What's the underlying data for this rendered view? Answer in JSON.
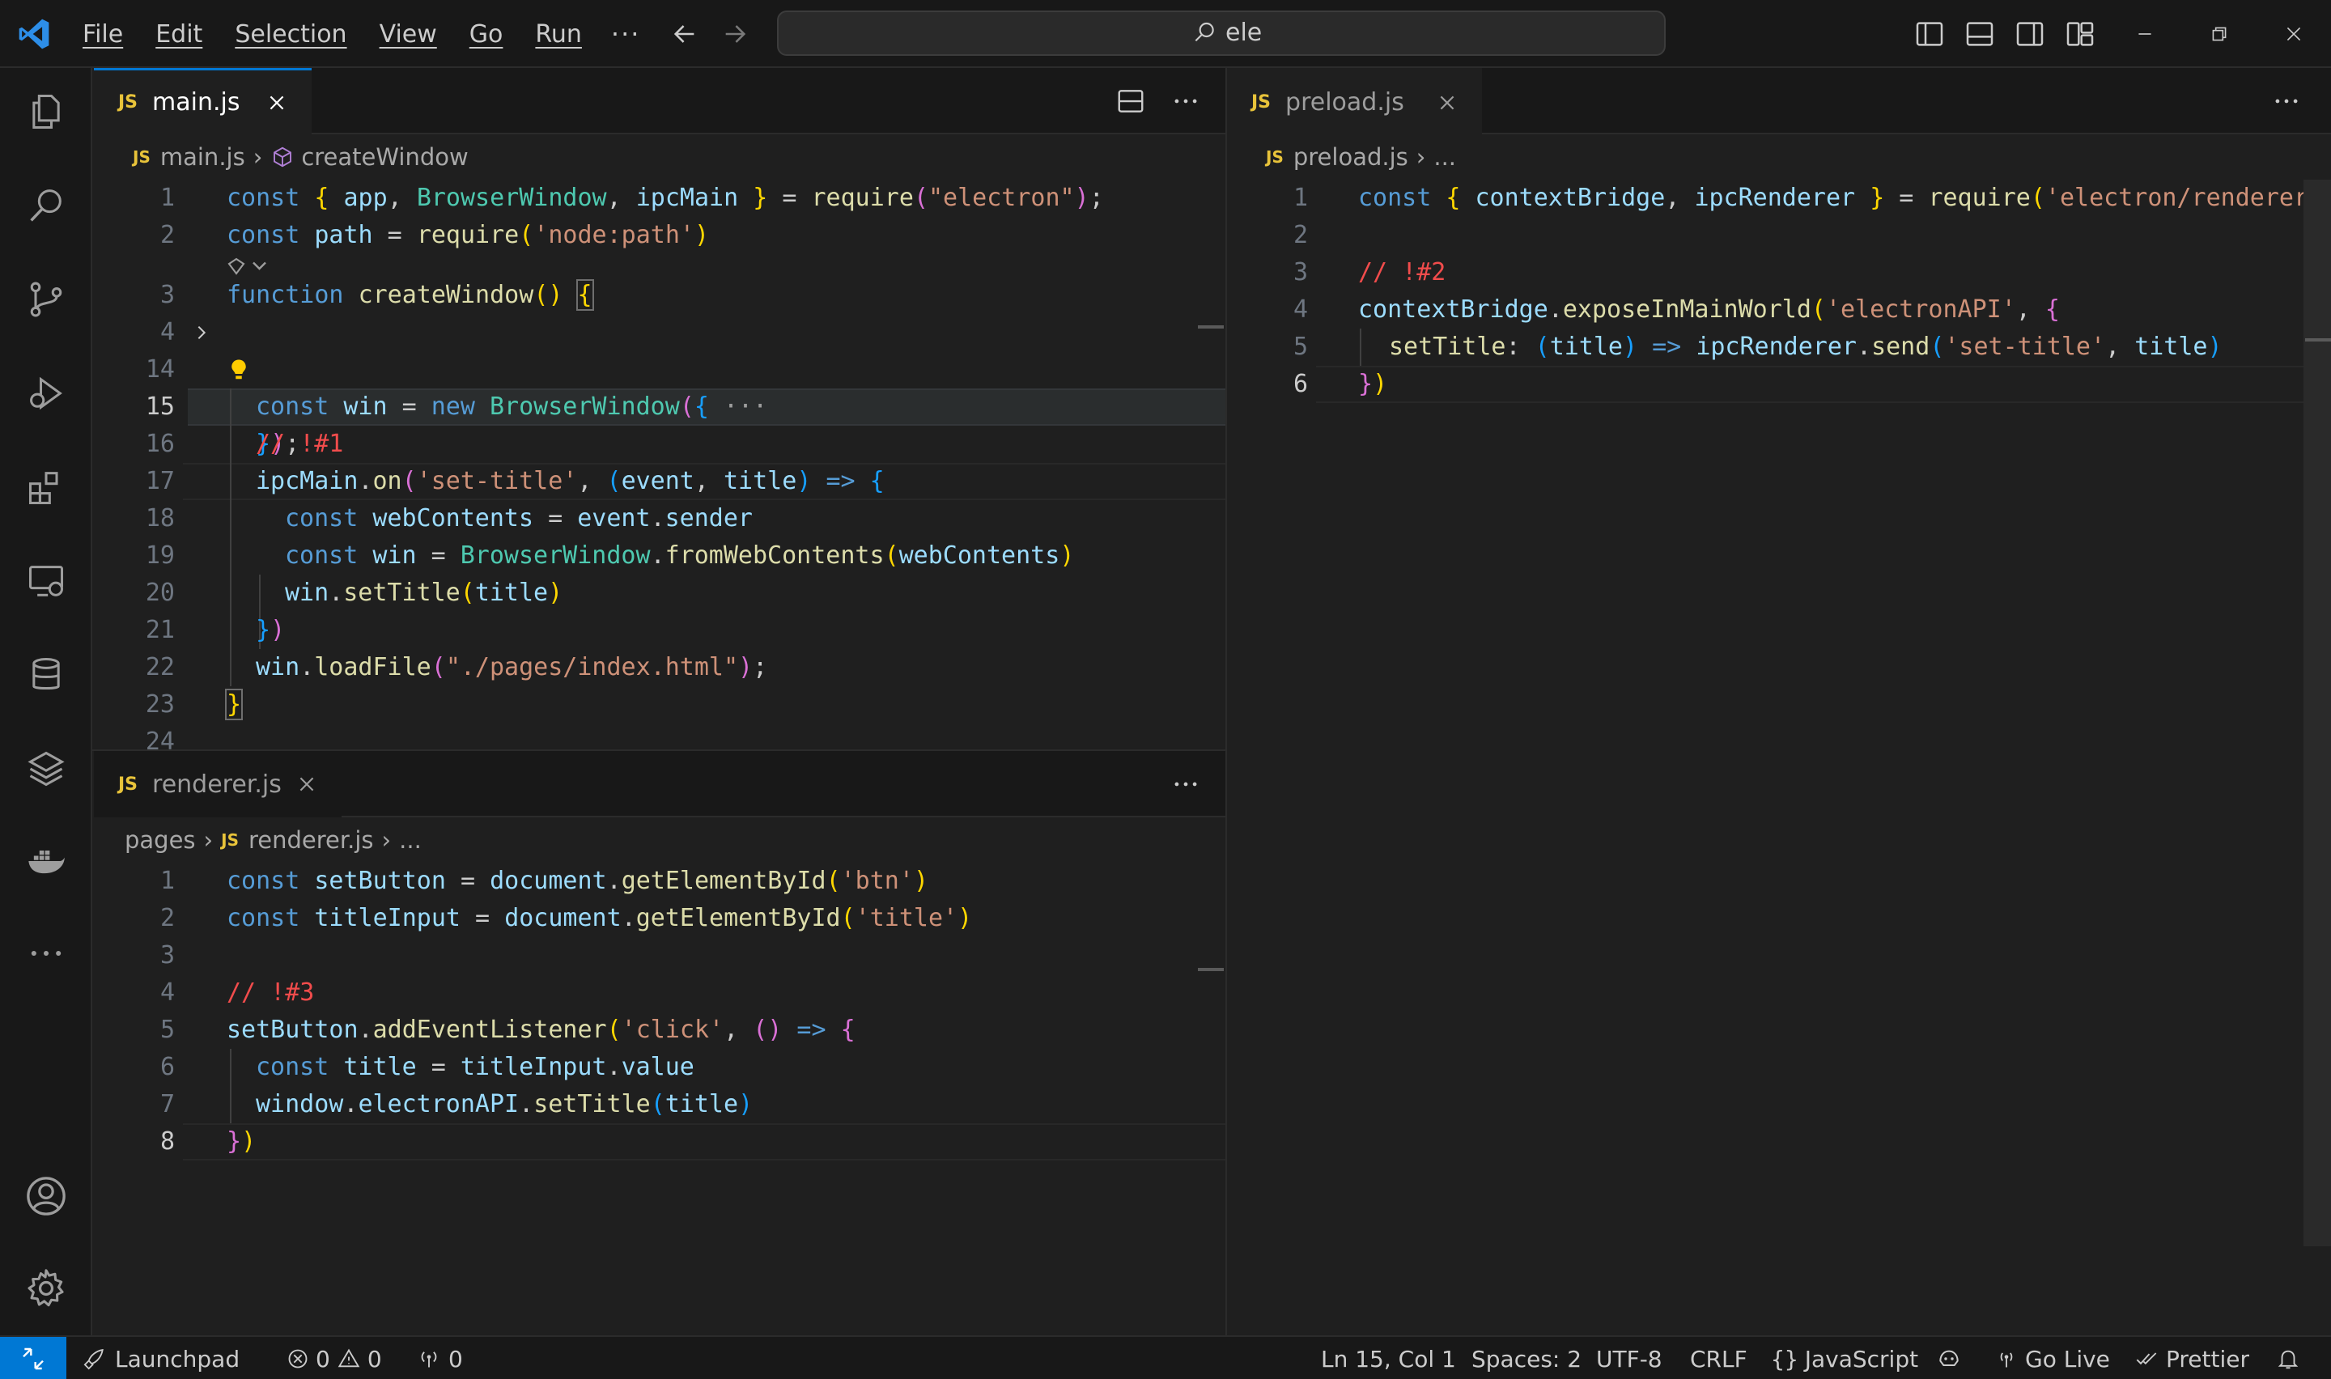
{
  "titlebar": {
    "menu": [
      "File",
      "Edit",
      "Selection",
      "View",
      "Go",
      "Run"
    ],
    "more": "···",
    "search_text": "ele"
  },
  "activitybar": {
    "icons": [
      "explorer-icon",
      "search-icon",
      "source-control-icon",
      "run-debug-icon",
      "extensions-icon",
      "remote-explorer-icon",
      "database-icon",
      "layers-icon",
      "docker-icon",
      "more-icon",
      "account-icon",
      "settings-gear-icon"
    ]
  },
  "editor_left_top": {
    "tab_label": "main.js",
    "js_badge": "JS",
    "breadcrumb": {
      "file": "main.js",
      "symbol": "createWindow"
    },
    "fold_ellipsis": "···",
    "line_numbers": [
      "1",
      "2",
      "3",
      "4",
      "14",
      "15",
      "16",
      "17",
      "18",
      "19",
      "20",
      "21",
      "22",
      "23",
      "24"
    ]
  },
  "editor_left_bottom": {
    "tab_label": "renderer.js",
    "js_badge": "JS",
    "breadcrumb": {
      "folder": "pages",
      "file": "renderer.js",
      "rest": "..."
    },
    "line_numbers": [
      "1",
      "2",
      "3",
      "4",
      "5",
      "6",
      "7",
      "8"
    ]
  },
  "editor_right": {
    "tab_label": "preload.js",
    "js_badge": "JS",
    "breadcrumb": {
      "file": "preload.js",
      "rest": "..."
    },
    "line_numbers": [
      "1",
      "2",
      "3",
      "4",
      "5",
      "6"
    ]
  },
  "statusbar": {
    "launchpad": "Launchpad",
    "errors": "0",
    "warnings": "0",
    "ports": "0",
    "position": "Ln 15, Col 1",
    "spaces": "Spaces: 2",
    "encoding": "UTF-8",
    "eol": "CRLF",
    "language": "JavaScript",
    "golive": "Go Live",
    "prettier": "Prettier"
  },
  "colors": {
    "accent": "#0078d4",
    "keyword": "#569cd6",
    "function": "#dcdcaa",
    "string": "#ce9178",
    "class": "#4ec9b0",
    "comment": "#f14c4c"
  }
}
